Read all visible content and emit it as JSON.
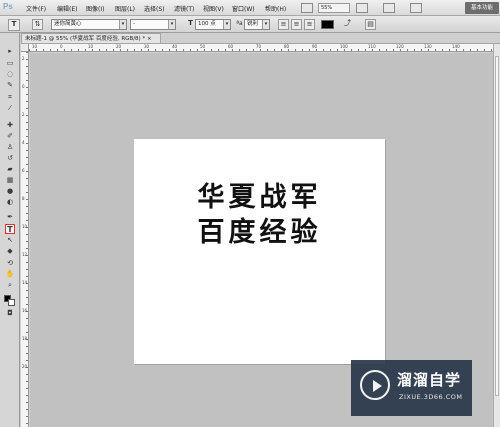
{
  "menubar": {
    "logo": "Ps",
    "menus": [
      "文件(F)",
      "编辑(E)",
      "图像(I)",
      "图层(L)",
      "选择(S)",
      "滤镜(T)",
      "视图(V)",
      "窗口(W)",
      "帮助(H)"
    ],
    "zoom": "55%",
    "workspace_label": "基本功能"
  },
  "options": {
    "font_family": "迷你简黄心",
    "font_style": "-",
    "font_size": "100 点",
    "antialias": "锐利",
    "text_color": "#000000"
  },
  "document": {
    "tab_title": "未标题-1 @ 55% (华夏战军 百度经验, RGB/8) * ",
    "ruler_h_ticks": [
      "10",
      "0",
      "10",
      "20",
      "30",
      "40",
      "50",
      "60",
      "70",
      "80",
      "90",
      "100",
      "110",
      "120",
      "130",
      "140"
    ],
    "ruler_v_ticks": [
      "2",
      "0",
      "2",
      "4",
      "6",
      "8",
      "10",
      "12",
      "14",
      "16",
      "18",
      "20"
    ],
    "line1": "华夏战军",
    "line2": "百度经验"
  },
  "watermark": {
    "title": "溜溜自学",
    "url": "ZIXUE.3D66.COM"
  },
  "colors": {
    "canvas": "#ffffff",
    "workspace": "#c1c1c1",
    "watermark_bg": "#28364a"
  }
}
